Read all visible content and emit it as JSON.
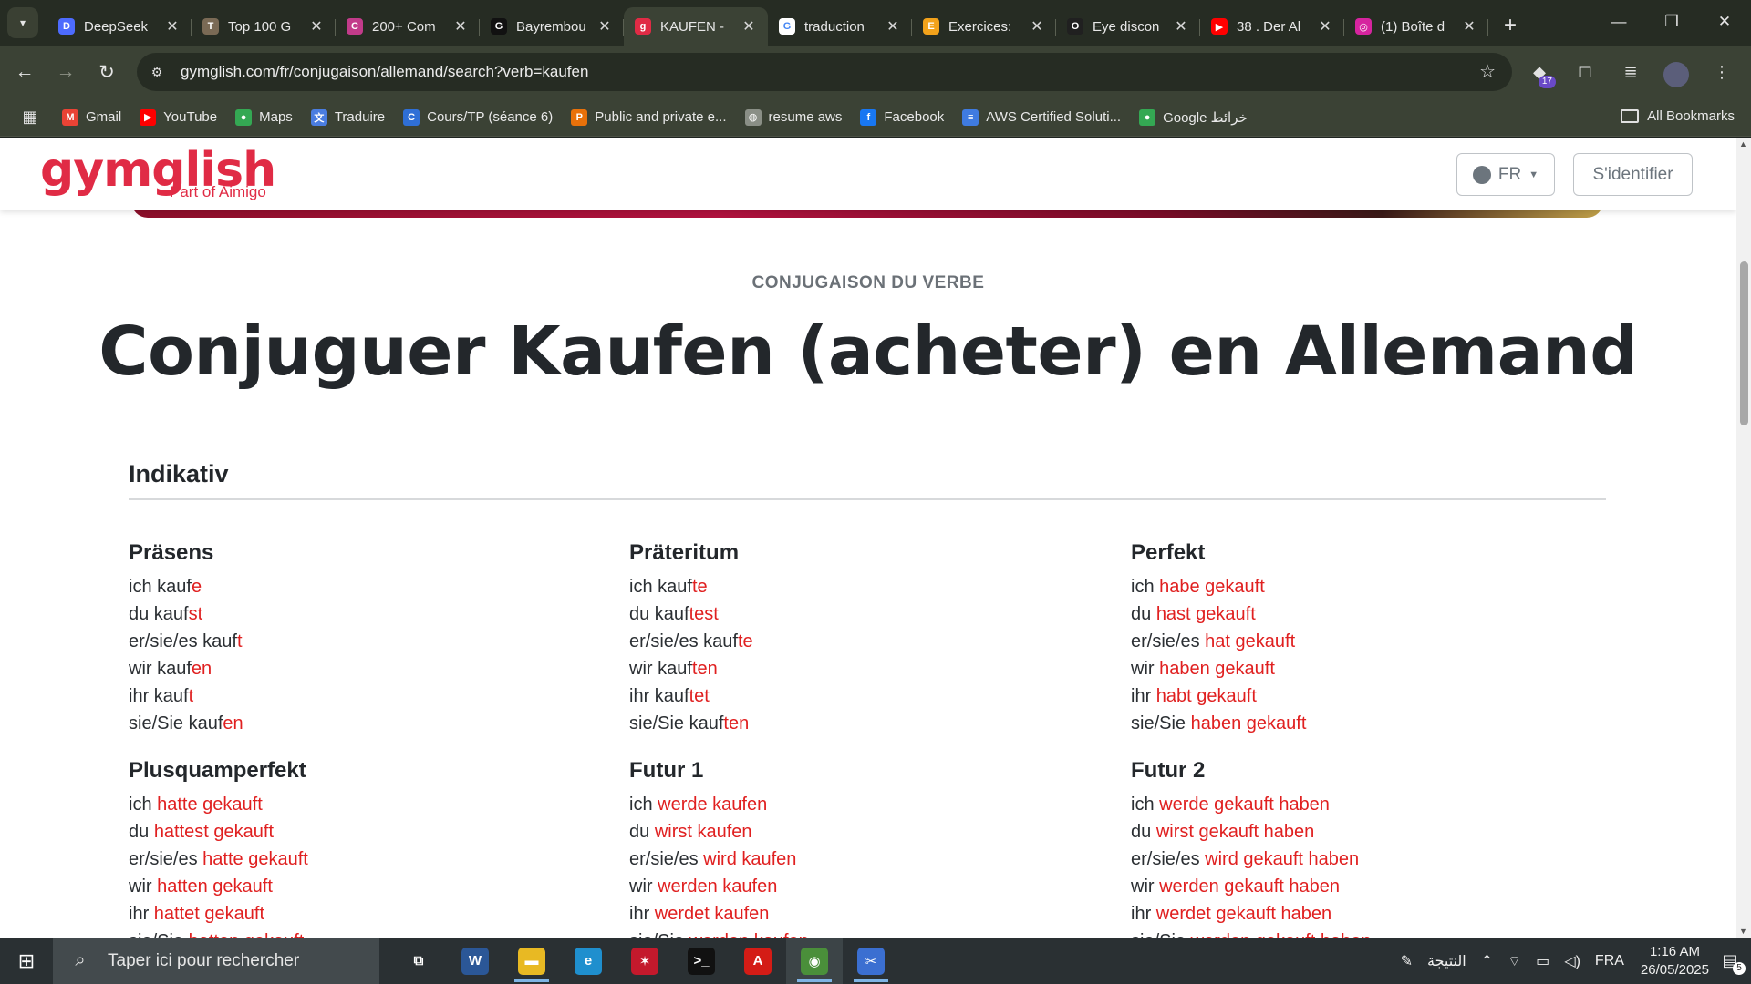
{
  "tabs": [
    {
      "title": "DeepSeek",
      "icon": "deepseek-icon",
      "color": "#4d6bfe",
      "glyph": "D"
    },
    {
      "title": "Top 100 G",
      "icon": "photo-icon",
      "color": "#7a6a55",
      "glyph": "T"
    },
    {
      "title": "200+ Com",
      "icon": "colorful-icon",
      "color": "#c23b8a",
      "glyph": "C"
    },
    {
      "title": "Bayrembou",
      "icon": "github-icon",
      "color": "#111111",
      "glyph": "G"
    },
    {
      "title": "KAUFEN - ",
      "icon": "gymglish-icon",
      "color": "#e02b45",
      "glyph": "g"
    },
    {
      "title": "traduction",
      "icon": "google-icon",
      "color": "#ffffff",
      "glyph": "G"
    },
    {
      "title": "Exercices: ",
      "icon": "pencil-icon",
      "color": "#f2a21b",
      "glyph": "E"
    },
    {
      "title": "Eye discon",
      "icon": "openai-icon",
      "color": "#202020",
      "glyph": "O"
    },
    {
      "title": "38 . Der Al",
      "icon": "youtube-icon",
      "color": "#ff0000",
      "glyph": "▶"
    },
    {
      "title": "(1) Boîte d",
      "icon": "instagram-icon",
      "color": "#d6249f",
      "glyph": "◎"
    }
  ],
  "address": {
    "url": "gymglish.com/fr/conjugaison/allemand/search?verb=kaufen"
  },
  "extension_badge": "17",
  "bookmarks": [
    {
      "label": "Gmail",
      "icon": "gmail-icon",
      "color": "#ea4335",
      "glyph": "M"
    },
    {
      "label": "YouTube",
      "icon": "youtube-icon",
      "color": "#ff0000",
      "glyph": "▶"
    },
    {
      "label": "Maps",
      "icon": "maps-pin-icon",
      "color": "#34a853",
      "glyph": "●"
    },
    {
      "label": "Traduire",
      "icon": "translate-icon",
      "color": "#4a7de0",
      "glyph": "文"
    },
    {
      "label": "Cours/TP (séance 6)",
      "icon": "classroom-icon",
      "color": "#2f6fd6",
      "glyph": "C"
    },
    {
      "label": "Public and private e...",
      "icon": "pdf-reader-icon",
      "color": "#e8710a",
      "glyph": "P"
    },
    {
      "label": "resume aws",
      "icon": "globe-icon",
      "color": "#8a8f86",
      "glyph": "◍"
    },
    {
      "label": "Facebook",
      "icon": "facebook-icon",
      "color": "#1877f2",
      "glyph": "f"
    },
    {
      "label": "AWS Certified Soluti...",
      "icon": "aws-icon",
      "color": "#3f7be0",
      "glyph": "≡"
    },
    {
      "label": "Google خرائط",
      "icon": "maps-pin-icon",
      "color": "#34a853",
      "glyph": "●"
    }
  ],
  "all_bookmarks": "All Bookmarks",
  "site": {
    "logo": "gymglish",
    "logo_sub": "Part of Aimigo",
    "lang_label": "FR",
    "login_label": "S'identifier"
  },
  "page": {
    "kicker": "CONJUGAISON DU VERBE",
    "title": "Conjuguer Kaufen (acheter) en Allemand",
    "section": "Indikativ"
  },
  "tenses": [
    {
      "name": "Präsens",
      "rows": [
        [
          "ich kauf",
          "e"
        ],
        [
          "du kauf",
          "st"
        ],
        [
          "er/sie/es kauf",
          "t"
        ],
        [
          "wir kauf",
          "en"
        ],
        [
          "ihr kauf",
          "t"
        ],
        [
          "sie/Sie kauf",
          "en"
        ]
      ]
    },
    {
      "name": "Präteritum",
      "rows": [
        [
          "ich kauf",
          "te"
        ],
        [
          "du kauf",
          "test"
        ],
        [
          "er/sie/es kauf",
          "te"
        ],
        [
          "wir kauf",
          "ten"
        ],
        [
          "ihr kauf",
          "tet"
        ],
        [
          "sie/Sie kauf",
          "ten"
        ]
      ]
    },
    {
      "name": "Perfekt",
      "rows": [
        [
          "ich ",
          "habe gekauft"
        ],
        [
          "du ",
          "hast gekauft"
        ],
        [
          "er/sie/es ",
          "hat gekauft"
        ],
        [
          "wir ",
          "haben gekauft"
        ],
        [
          "ihr ",
          "habt gekauft"
        ],
        [
          "sie/Sie ",
          "haben gekauft"
        ]
      ]
    },
    {
      "name": "Plusquamperfekt",
      "rows": [
        [
          "ich ",
          "hatte gekauft"
        ],
        [
          "du ",
          "hattest gekauft"
        ],
        [
          "er/sie/es ",
          "hatte gekauft"
        ],
        [
          "wir ",
          "hatten gekauft"
        ],
        [
          "ihr ",
          "hattet gekauft"
        ],
        [
          "sie/Sie ",
          "hatten gekauft"
        ]
      ]
    },
    {
      "name": "Futur 1",
      "rows": [
        [
          "ich ",
          "werde kaufen"
        ],
        [
          "du ",
          "wirst kaufen"
        ],
        [
          "er/sie/es ",
          "wird kaufen"
        ],
        [
          "wir ",
          "werden kaufen"
        ],
        [
          "ihr ",
          "werdet kaufen"
        ],
        [
          "sie/Sie ",
          "werden kaufen"
        ]
      ]
    },
    {
      "name": "Futur 2",
      "rows": [
        [
          "ich ",
          "werde gekauft haben"
        ],
        [
          "du ",
          "wirst gekauft haben"
        ],
        [
          "er/sie/es ",
          "wird gekauft haben"
        ],
        [
          "wir ",
          "werden gekauft haben"
        ],
        [
          "ihr ",
          "werdet gekauft haben"
        ],
        [
          "sie/Sie ",
          "werden gekauft haben"
        ]
      ]
    }
  ],
  "taskbar": {
    "search_placeholder": "Taper ici pour rechercher",
    "apps": [
      {
        "name": "task-view-icon",
        "glyph": "⧉",
        "color": "#2a3033",
        "running": false
      },
      {
        "name": "word-icon",
        "glyph": "W",
        "color": "#2b5797",
        "running": false
      },
      {
        "name": "file-explorer-icon",
        "glyph": "▬",
        "color": "#e8b923",
        "running": true
      },
      {
        "name": "edge-icon",
        "glyph": "e",
        "color": "#1f8fce",
        "running": false
      },
      {
        "name": "app-red-icon",
        "glyph": "✶",
        "color": "#c4192c",
        "running": false
      },
      {
        "name": "terminal-icon",
        "glyph": ">_",
        "color": "#111111",
        "running": false
      },
      {
        "name": "acrobat-icon",
        "glyph": "A",
        "color": "#d41c16",
        "running": false
      },
      {
        "name": "chrome-icon",
        "glyph": "◉",
        "color": "#4a8f3a",
        "running": true
      },
      {
        "name": "snipping-tool-icon",
        "glyph": "✂",
        "color": "#3b6fd1",
        "running": true
      }
    ],
    "tray_label": "النتيجة",
    "language": "FRA",
    "time": "1:16 AM",
    "date": "26/05/2025",
    "notifications": "5"
  }
}
